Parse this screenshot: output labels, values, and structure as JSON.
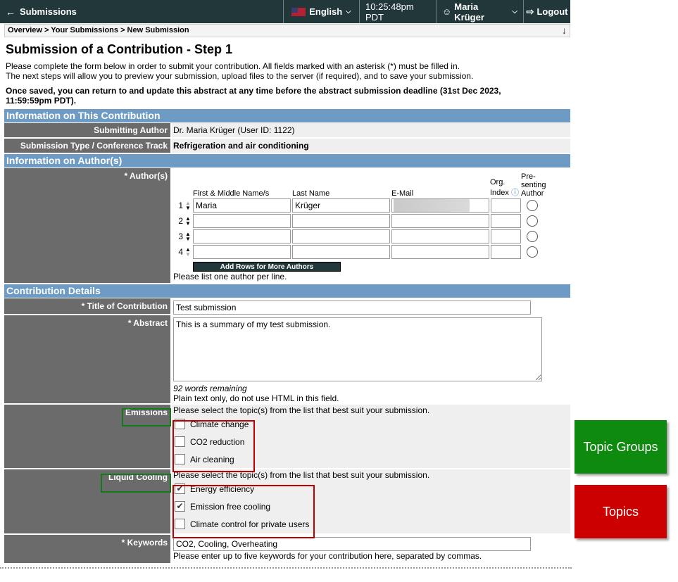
{
  "topbar": {
    "back_label": "Submissions",
    "language": "English",
    "time": "10:25:48pm PDT",
    "user": "Maria Krüger",
    "logout": "Logout"
  },
  "breadcrumb": "Overview > Your Submissions > New Submission",
  "page_title": "Submission of a Contribution - Step 1",
  "intro_line1": "Please complete the form below in order to submit your contribution. All fields marked with an asterisk (*) must be filled in.",
  "intro_line2": "The next steps will allow you to preview your submission, upload files to the server (if required), and to save your submission.",
  "intro_bold": "Once saved, you can return to and update this abstract at any time before the abstract submission deadline (31st Dec 2023, 11:59:59pm PDT).",
  "sections": {
    "info": "Information on This Contribution",
    "authors": "Information on Author(s)",
    "details": "Contribution Details"
  },
  "submitting_author": {
    "label": "Submitting Author",
    "value": "Dr. Maria Krüger (User ID: 1122)"
  },
  "submission_type": {
    "label": "Submission Type / Conference Track",
    "value": "Refrigeration and air conditioning"
  },
  "authors": {
    "label": "* Author(s)",
    "col_first": "First & Middle Name/s",
    "col_last": "Last Name",
    "col_email": "E-Mail",
    "col_org": "Org. Index",
    "col_presenting": "Pre-senting Author",
    "rows": [
      {
        "num": "1",
        "first": "Maria",
        "last": "Krüger",
        "email": ""
      },
      {
        "num": "2",
        "first": "",
        "last": "",
        "email": ""
      },
      {
        "num": "3",
        "first": "",
        "last": "",
        "email": ""
      },
      {
        "num": "4",
        "first": "",
        "last": "",
        "email": ""
      }
    ],
    "add_rows": "Add Rows for More Authors",
    "hint": "Please list one author per line."
  },
  "title": {
    "label": "* Title of Contribution",
    "value": "Test submission"
  },
  "abstract": {
    "label": "* Abstract",
    "value": "This is a summary of my test submission.",
    "words_remaining": "92 words remaining",
    "hint": "Plain text only, do not use HTML in this field."
  },
  "emissions": {
    "label": "Emissions",
    "hint": "Please select the topic(s) from the list that best suit your submission.",
    "options": [
      {
        "label": "Climate change",
        "checked": false
      },
      {
        "label": "CO2 reduction",
        "checked": false
      },
      {
        "label": "Air cleaning",
        "checked": false
      }
    ]
  },
  "liquid_cooling": {
    "label": "Liquid Cooling",
    "hint": "Please select the topic(s) from the list that best suit your submission.",
    "options": [
      {
        "label": "Energy efficiency",
        "checked": true
      },
      {
        "label": "Emission free cooling",
        "checked": true
      },
      {
        "label": "Climate control for private users",
        "checked": false
      }
    ]
  },
  "keywords": {
    "label": "* Keywords",
    "value": "CO2, Cooling, Overheating",
    "hint": "Please enter up to five keywords for your contribution here, separated by commas."
  },
  "callouts": {
    "topic_groups": "Topic Groups",
    "topics": "Topics"
  },
  "colors": {
    "topbar": "#22373a",
    "section_header": "#6d9bc3",
    "label_bg": "#6b6b6b",
    "callout_green": "#0e8a0e",
    "callout_red": "#cc0000"
  }
}
